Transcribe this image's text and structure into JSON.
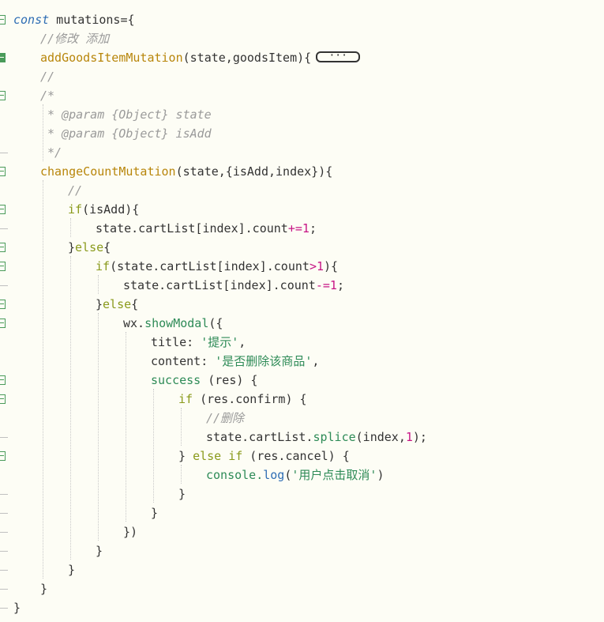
{
  "lines": {
    "l1": [
      "const",
      " mutations={"
    ],
    "l2": "//修改 添加",
    "l3": [
      "addGoodsItemMutation",
      "(state,goodsItem){"
    ],
    "l3_collapsed": "···",
    "l4": "//",
    "l5": "/*",
    "l6": "* @param {Object} state",
    "l7": "* @param {Object} isAdd",
    "l8": "*/",
    "l9": [
      "changeCountMutation",
      "(state,{isAdd,index}){"
    ],
    "l10": "//",
    "l11": [
      "if",
      "(isAdd){"
    ],
    "l12": [
      "state.cartList[index].count",
      "+=",
      "1",
      ";"
    ],
    "l13": [
      "}",
      "else",
      "{"
    ],
    "l14": [
      "if",
      "(state.cartList[index].count",
      ">",
      "1",
      "){"
    ],
    "l15": [
      "state.cartList[index].count",
      "-=",
      "1",
      ";"
    ],
    "l16": [
      "}",
      "else",
      "{"
    ],
    "l17": [
      "wx.",
      "showModal",
      "({"
    ],
    "l18": [
      "title: ",
      "'提示'",
      ","
    ],
    "l19": [
      "content: ",
      "'是否删除该商品'",
      ","
    ],
    "l20": [
      "success",
      " (res) {"
    ],
    "l21": [
      "if",
      " (res.confirm) {"
    ],
    "l22": "//删除",
    "l23": [
      "state.cartList.",
      "splice",
      "(index,",
      "1",
      ");"
    ],
    "l24": [
      "} ",
      "else if",
      " (res.cancel) {"
    ],
    "l25": [
      "console.",
      "log",
      "(",
      "'用户点击取消'",
      ")"
    ],
    "l26": "}",
    "l27": "}",
    "l28": "})",
    "l29": "}",
    "l30": "}",
    "l31": "}",
    "l32": "}"
  }
}
